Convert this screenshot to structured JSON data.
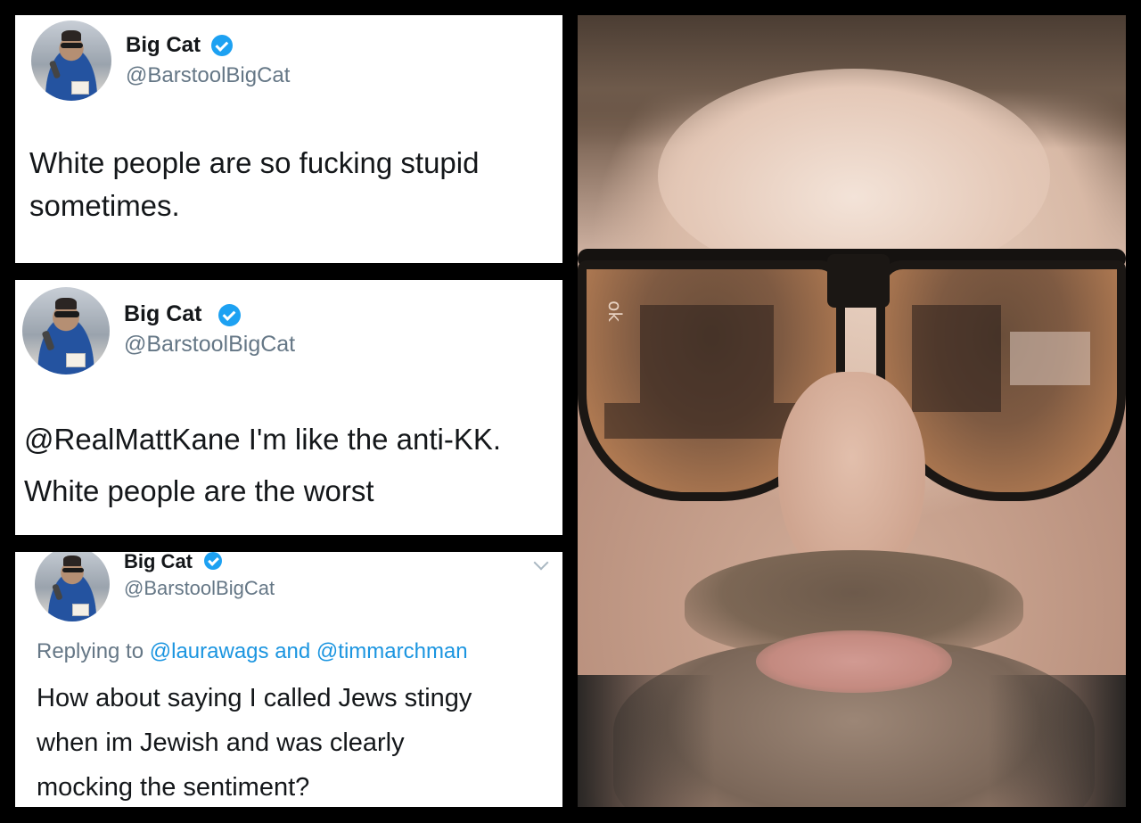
{
  "tweets": [
    {
      "name": "Big Cat",
      "handle": "@BarstoolBigCat",
      "text_line1": "White people are so fucking stupid",
      "text_line2": "sometimes."
    },
    {
      "name": "Big Cat",
      "handle": "@BarstoolBigCat",
      "text_line1": "@RealMattKane I'm like the anti-KK.",
      "text_line2": "White people are the worst"
    },
    {
      "name": "Big Cat",
      "handle": "@BarstoolBigCat",
      "reply_prefix": "Replying to",
      "reply_user1": "@laurawags",
      "reply_and": "and",
      "reply_user2": "@timmarchman",
      "text_line1": "How about saying I called Jews stingy",
      "text_line2": "when im Jewish and was clearly",
      "text_line3": "mocking the sentiment?"
    }
  ],
  "photo": {
    "sunglasses_logo": "ok"
  },
  "colors": {
    "verified_blue": "#1da1f2",
    "link_blue": "#1b95e0",
    "handle_gray": "#657786",
    "text_dark": "#14171a",
    "background": "#000000"
  },
  "icons": [
    "verified-badge-icon",
    "chevron-down-icon"
  ]
}
